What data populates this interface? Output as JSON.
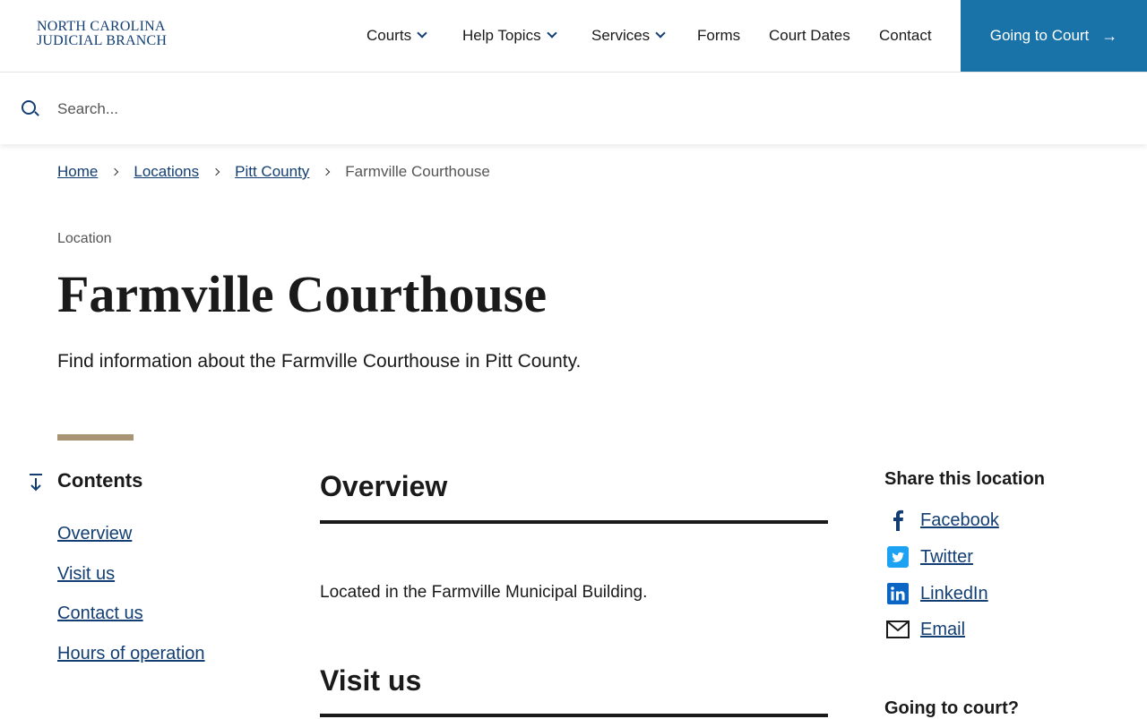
{
  "brand": {
    "line1": "NORTH CAROLINA",
    "line2": "JUDICIAL BRANCH"
  },
  "nav": {
    "courts": "Courts",
    "help_topics": "Help Topics",
    "services": "Services",
    "forms": "Forms",
    "court_dates": "Court Dates",
    "contact": "Contact",
    "cta": "Going to Court"
  },
  "search": {
    "placeholder": "Search..."
  },
  "breadcrumb": {
    "home": "Home",
    "locations": "Locations",
    "county": "Pitt County",
    "current": "Farmville Courthouse"
  },
  "page": {
    "eyebrow": "Location",
    "title": "Farmville Courthouse",
    "lede": "Find information about the Farmville Courthouse in Pitt County."
  },
  "toc": {
    "title": "Contents",
    "items": [
      "Overview",
      "Visit us",
      "Contact us",
      "Hours of operation"
    ]
  },
  "main": {
    "overview_title": "Overview",
    "overview_text": "Located in the Farmville Municipal Building.",
    "visit_title": "Visit us"
  },
  "share": {
    "title": "Share this location",
    "facebook": "Facebook",
    "twitter": "Twitter",
    "linkedin": "LinkedIn",
    "email": "Email"
  },
  "sidebar": {
    "going_to_court": "Going to court?"
  },
  "colors": {
    "brand_blue": "#123e73",
    "cta_blue": "#1a73a8",
    "accent_tan": "#a89472",
    "twitter_blue": "#1da1f2",
    "linkedin_blue": "#0a66c2"
  }
}
